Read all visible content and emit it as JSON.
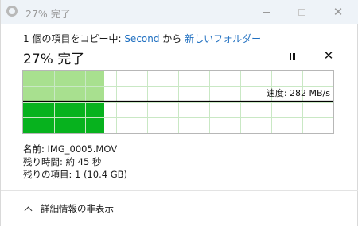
{
  "window": {
    "title": "27% 完了",
    "icon": "copy-progress-icon"
  },
  "header": {
    "copy_prefix": "1 個の項目をコピー中: ",
    "source": "Second",
    "from_word": " から ",
    "destination": "新しいフォルダー",
    "progress_text": "27% 完了",
    "progress_fraction": 0.27
  },
  "controls": {
    "pause_icon": "pause-icon",
    "stop_icon": "close-icon",
    "stop_glyph": "✕"
  },
  "graph": {
    "speed_text": "速度: 282 MB/s",
    "colors": {
      "done_light": "#a8e08f",
      "done_dark": "#07b21e",
      "grid": "#c9e8c4",
      "line": "#000000"
    }
  },
  "details": {
    "name_label": "名前: ",
    "name_value": "IMG_0005.MOV",
    "time_label": "残り時間: ",
    "time_value": "約 45 秒",
    "items_label": "残りの項目: ",
    "items_value": "1 (10.4 GB)"
  },
  "footer": {
    "toggle_label": "詳細情報の非表示"
  }
}
